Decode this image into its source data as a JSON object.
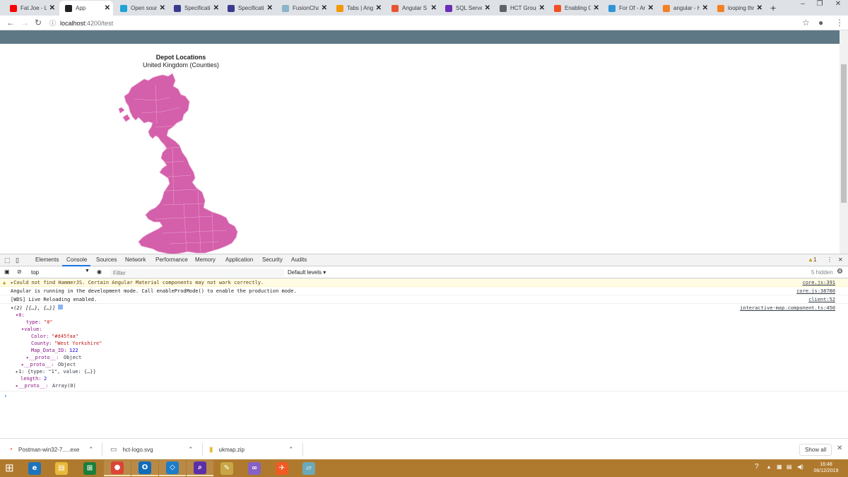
{
  "tabs": [
    {
      "label": "Fat Joe - Le",
      "icon": "youtube-icon",
      "color": "#ff0000"
    },
    {
      "label": "App",
      "icon": "angular-icon",
      "color": "#202124",
      "active": true
    },
    {
      "label": "Open sour",
      "icon": "open-source-icon",
      "color": "#1fa2d6"
    },
    {
      "label": "Specificatio",
      "icon": "spec-icon",
      "color": "#3b3a8f"
    },
    {
      "label": "Specificatio",
      "icon": "spec-icon",
      "color": "#3b3a8f"
    },
    {
      "label": "FusionChar",
      "icon": "fusioncharts-icon",
      "color": "#8ab4c8"
    },
    {
      "label": "Tabs | Angu",
      "icon": "tabs-icon",
      "color": "#f29900"
    },
    {
      "label": "Angular S",
      "icon": "stackoverflow-icon",
      "color": "#e8542e"
    },
    {
      "label": "SQL Serve",
      "icon": "sql-icon",
      "color": "#6a2db5"
    },
    {
      "label": "HCT Group",
      "icon": "globe-icon",
      "color": "#5f6368"
    },
    {
      "label": "Enabling C",
      "icon": "microsoft-icon",
      "color": "#f25022"
    },
    {
      "label": "For Of - Ar",
      "icon": "forof-icon",
      "color": "#2f94d6"
    },
    {
      "label": "angular - H",
      "icon": "stackoverflow-icon",
      "color": "#f48024"
    },
    {
      "label": "looping thr",
      "icon": "stackoverflow-icon",
      "color": "#f48024"
    }
  ],
  "address": {
    "host": "localhost",
    "path": ":4200/test"
  },
  "map": {
    "title": "Depot Locations",
    "subtitle": "United Kingdom (Counties)",
    "fill_color": "#d45faa"
  },
  "devtools": {
    "tabs": [
      "Elements",
      "Console",
      "Sources",
      "Network",
      "Performance",
      "Memory",
      "Application",
      "Security",
      "Audits"
    ],
    "active_tab": "Console",
    "warning_count": "1",
    "context": "top",
    "filter_placeholder": "Filter",
    "levels": "Default levels ▾",
    "hidden": "5 hidden"
  },
  "console": {
    "messages": [
      {
        "text": "▸Could not find HammerJS. Certain Angular Material components may not work correctly.",
        "source": "core.js:391",
        "level": "warn"
      },
      {
        "text": "Angular is running in the development mode. Call enableProdMode() to enable the production mode.",
        "source": "core.js:38780",
        "level": "info"
      },
      {
        "text": "[WDS] Live Reloading enabled.",
        "source": "client:52",
        "level": "info"
      }
    ],
    "tree_source": "interactive-map.component.ts:450",
    "tree": {
      "header": "▾(2) [{…}, {…}]",
      "item0": "▾0:",
      "type_key": "type:",
      "type_val": "\"0\"",
      "value_key": "▾value:",
      "color_key": "Color:",
      "color_val": "\"#d45faa\"",
      "county_key": "County:",
      "county_val": "\"West Yorkshire\"",
      "mapid_key": "Map_Data_ID:",
      "mapid_val": "122",
      "proto1_key": "▸__proto__:",
      "proto1_val": "Object",
      "proto2_key": "▸__proto__:",
      "proto2_val": "Object",
      "item1": "▸1: {type: \"1\", value: {…}}",
      "length_key": "length:",
      "length_val": "2",
      "proto3_key": "▸__proto__:",
      "proto3_val": "Array(0)"
    },
    "prompt": "›"
  },
  "downloads": {
    "items": [
      {
        "name": "Postman-win32-7.....exe",
        "icon": "postman-icon"
      },
      {
        "name": "hct-logo.svg",
        "icon": "file-icon"
      },
      {
        "name": "ukmap.zip",
        "icon": "zip-icon"
      }
    ],
    "show_all": "Show all"
  },
  "taskbar": {
    "apps": [
      {
        "name": "edge-icon",
        "glyph": "e",
        "color": "#1e73be"
      },
      {
        "name": "file-explorer-icon",
        "glyph": "▤",
        "color": "#e8b93a"
      },
      {
        "name": "calculator-icon",
        "glyph": "⊞",
        "color": "#1b7e3a"
      },
      {
        "name": "chrome-icon",
        "glyph": "●",
        "color": "#db4437",
        "open": true
      },
      {
        "name": "outlook-icon",
        "glyph": "O",
        "color": "#0f6cbd",
        "open": true
      },
      {
        "name": "vscode-icon",
        "glyph": "◇",
        "color": "#1d7dc8",
        "open": true
      },
      {
        "name": "search-app-icon",
        "glyph": "⌕",
        "color": "#5b2fa8",
        "open": true
      },
      {
        "name": "tools-icon",
        "glyph": "✎",
        "color": "#c8a646"
      },
      {
        "name": "visual-studio-icon",
        "glyph": "∞",
        "color": "#8661c5"
      },
      {
        "name": "postman-icon",
        "glyph": "✈",
        "color": "#ef5b25"
      },
      {
        "name": "notes-icon",
        "glyph": "▱",
        "color": "#6ba9b8"
      }
    ],
    "time": "16:48",
    "date": "06/12/2019"
  }
}
